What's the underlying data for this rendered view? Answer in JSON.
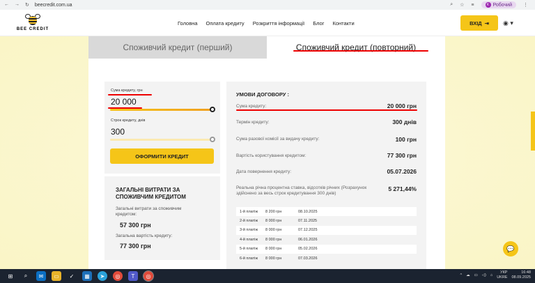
{
  "browser": {
    "url": "beecredit.com.ua",
    "profile": "Робочий",
    "profile_initial": "К"
  },
  "header": {
    "logo_text": "BEE CREDIT",
    "nav": [
      "Головна",
      "Оплата кредиту",
      "Розкриття інформації",
      "Блог",
      "Контакти"
    ],
    "login_label": "ВХІД"
  },
  "tabs": {
    "first": "Споживчий кредит (перший)",
    "repeat": "Споживчий кредит (повторний)"
  },
  "calculator": {
    "amount_label": "Сума кредиту, грн",
    "amount_value": "20 000",
    "term_label": "Строк кредиту, днів",
    "term_value": "300",
    "amount_fill": 1.0,
    "term_fill": 1.0,
    "apply_label": "ОФОРМИТИ КРЕДИТ"
  },
  "costs": {
    "title": "ЗАГАЛЬНІ ВИТРАТИ ЗА СПОЖИВЧИМ КРЕДИТОМ",
    "total_label": "Загальні витрати за споживчим кредитом:",
    "total_value": "57 300 грн",
    "total_cost_label": "Загальна вартість кредиту:",
    "total_cost_value": "77 300 грн"
  },
  "terms": {
    "title": "УМОВИ ДОГОВОРУ :",
    "rows": [
      {
        "label": "Сума кредиту:",
        "value": "20 000 грн"
      },
      {
        "label": "Термін кредиту:",
        "value": "300 днів"
      },
      {
        "label": "Сума разової комісії за видачу кредиту:",
        "value": "100 грн"
      },
      {
        "label": "Вартість користування кредитом:",
        "value": "77 300 грн"
      },
      {
        "label": "Дата повернення кредиту:",
        "value": "05.07.2026"
      },
      {
        "label": "Реальна річна процентна ставка, відсотків річних (Розрахунок здійснено за весь строк кредитування 300 днів)",
        "value": "5 271,44%"
      }
    ],
    "schedule": [
      {
        "n": "1-й платіж",
        "amount": "8 200 грн",
        "date": "08.10.2025"
      },
      {
        "n": "2-й платіж",
        "amount": "8 000 грн",
        "date": "07.11.2025"
      },
      {
        "n": "3-й платіж",
        "amount": "8 000 грн",
        "date": "07.12.2025"
      },
      {
        "n": "4-й платіж",
        "amount": "8 000 грн",
        "date": "06.01.2026"
      },
      {
        "n": "5-й платіж",
        "amount": "8 000 грн",
        "date": "05.02.2026"
      },
      {
        "n": "6-й платіж",
        "amount": "8 000 грн",
        "date": "07.03.2026"
      }
    ]
  },
  "taskbar": {
    "lang": "УКР",
    "layout": "UKRE",
    "time": "16:48",
    "date": "08.09.2025"
  }
}
